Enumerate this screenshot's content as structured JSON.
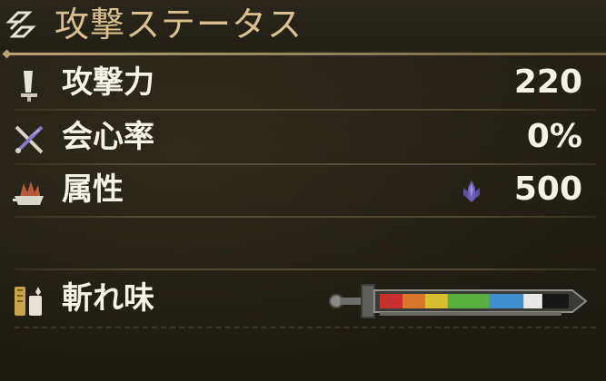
{
  "header": {
    "title": "攻撃ステータス",
    "icon": "weapon-status-icon"
  },
  "stats": [
    {
      "id": "attack",
      "label": "攻撃力",
      "value": "220",
      "icon": "attack-icon"
    },
    {
      "id": "affinity",
      "label": "会心率",
      "value": "0%",
      "icon": "affinity-icon"
    },
    {
      "id": "element",
      "label": "属性",
      "value": "500",
      "icon": "element-icon",
      "element_icon": "dragon-element-icon"
    },
    {
      "id": "sharpness",
      "label": "斬れ味",
      "icon": "sharpness-icon"
    }
  ],
  "sharpness": {
    "segments": [
      {
        "name": "red",
        "color": "#c8302b",
        "fraction": 0.12
      },
      {
        "name": "orange",
        "color": "#d9752c",
        "fraction": 0.12
      },
      {
        "name": "yellow",
        "color": "#d7c02f",
        "fraction": 0.12
      },
      {
        "name": "green",
        "color": "#58b040",
        "fraction": 0.22
      },
      {
        "name": "blue",
        "color": "#3f8ed0",
        "fraction": 0.18
      },
      {
        "name": "white",
        "color": "#e8e8e8",
        "fraction": 0.1
      },
      {
        "name": "empty",
        "color": "#161616",
        "fraction": 0.14
      }
    ]
  },
  "colors": {
    "title": "#d9c08e",
    "accent_line": "#b9a477",
    "background": "#1f1c14"
  }
}
